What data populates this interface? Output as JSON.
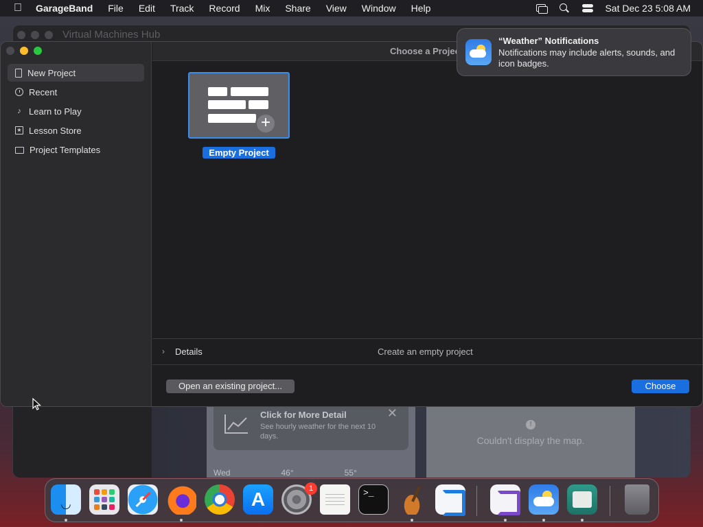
{
  "menubar": {
    "app_name": "GarageBand",
    "menus": [
      "File",
      "Edit",
      "Track",
      "Record",
      "Mix",
      "Share",
      "View",
      "Window",
      "Help"
    ],
    "datetime": "Sat Dec 23  5:08 AM"
  },
  "background_window": {
    "title": "Virtual Machines Hub",
    "weather_card": {
      "title": "Click for More Detail",
      "subtitle": "See hourly weather for the next 10 days.",
      "row_day": "Wed",
      "row_low": "46°",
      "row_high": "55°"
    },
    "map_message": "Couldn't display the map."
  },
  "garageband": {
    "window_title": "Choose a Project",
    "sidebar": {
      "items": [
        {
          "label": "New Project",
          "icon": "document-icon"
        },
        {
          "label": "Recent",
          "icon": "clock-icon"
        },
        {
          "label": "Learn to Play",
          "icon": "music-note-icon"
        },
        {
          "label": "Lesson Store",
          "icon": "star-icon"
        },
        {
          "label": "Project Templates",
          "icon": "folder-icon"
        }
      ]
    },
    "template": {
      "label": "Empty Project"
    },
    "details": {
      "label": "Details",
      "description": "Create an empty project"
    },
    "buttons": {
      "open_existing": "Open an existing project...",
      "choose": "Choose"
    }
  },
  "notification": {
    "title": "“Weather” Notifications",
    "body": "Notifications may include alerts, sounds, and icon badges."
  },
  "dock": {
    "apps": [
      "Finder",
      "Launchpad",
      "Safari",
      "Firefox",
      "Chrome",
      "App Store",
      "System Settings",
      "TextEdit",
      "Terminal",
      "GarageBand",
      "Visual Studio Code",
      "Visual Studio",
      "Weather",
      "Archive Utility",
      "Trash"
    ],
    "settings_badge": "1"
  }
}
